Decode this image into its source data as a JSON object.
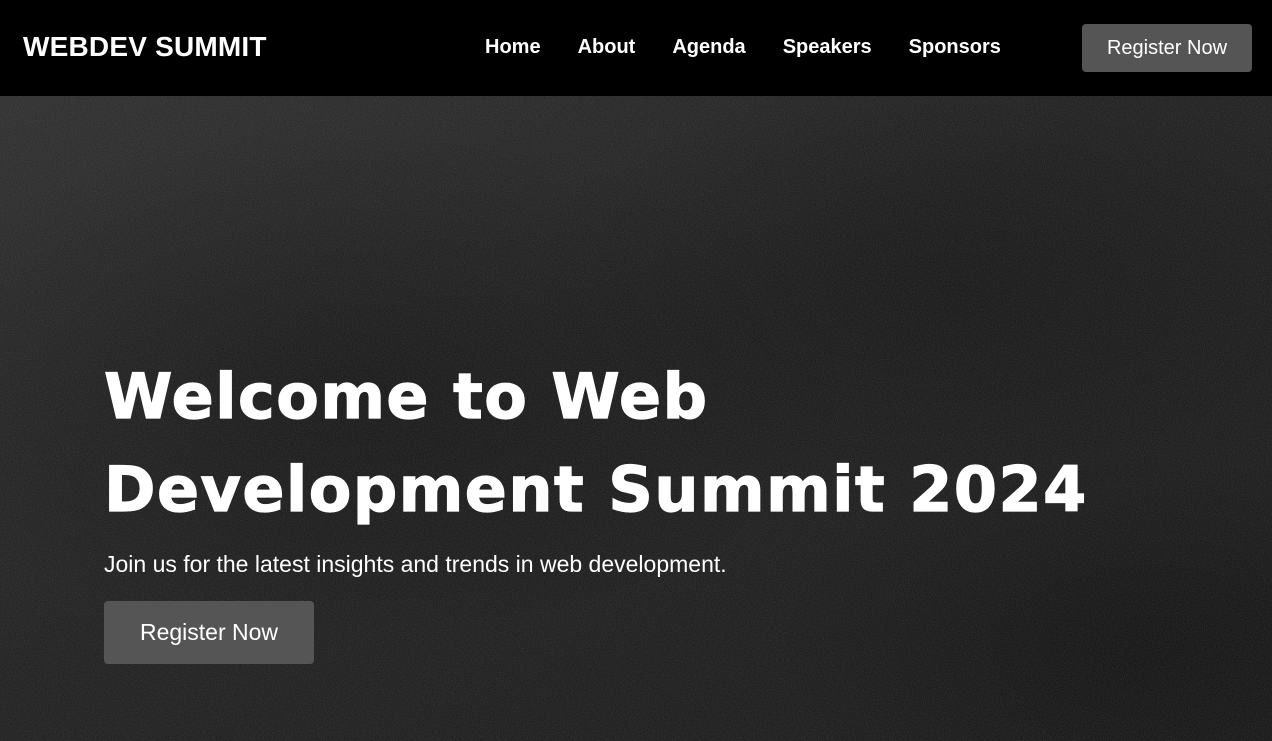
{
  "header": {
    "brand": "WEBDEV SUMMIT",
    "nav": {
      "home": "Home",
      "about": "About",
      "agenda": "Agenda",
      "speakers": "Speakers",
      "sponsors": "Sponsors"
    },
    "register_label": "Register Now"
  },
  "hero": {
    "title": "Welcome to Web Development Summit 2024",
    "subtitle": "Join us for the latest insights and trends in web development.",
    "register_label": "Register Now",
    "background": "dark-sand-texture"
  },
  "colors": {
    "navbar_bg": "#000000",
    "button_bg": "#555555",
    "text": "#ffffff",
    "hero_bg": "#1c1c1c"
  }
}
